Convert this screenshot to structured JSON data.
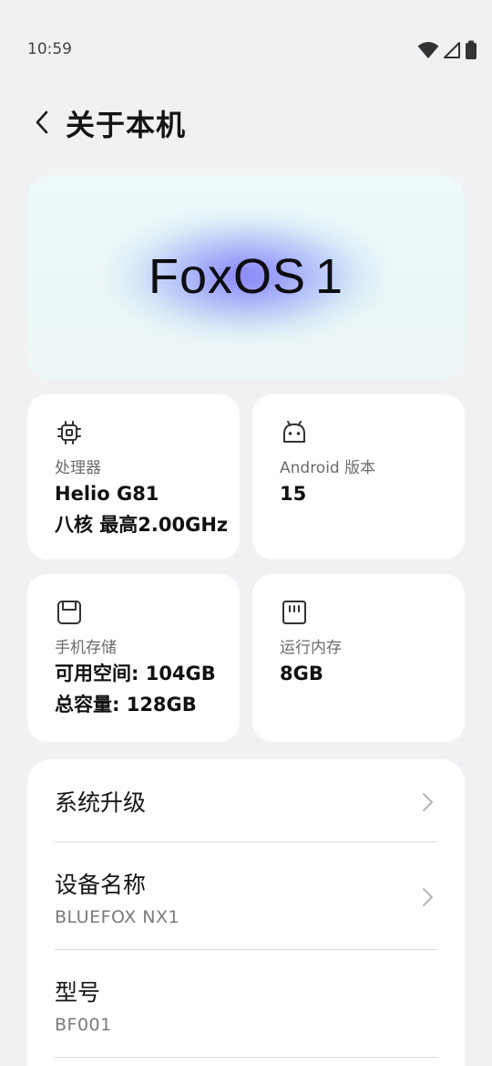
{
  "status_bar": {
    "time": "10:59",
    "icons": [
      "wifi-icon",
      "signal-icon",
      "battery-icon"
    ]
  },
  "header": {
    "back_icon": "back-arrow-icon",
    "title": "关于本机"
  },
  "banner": {
    "logo_text": "FoxOS",
    "logo_version": "1"
  },
  "cards": {
    "processor": {
      "icon": "chip-icon",
      "label": "处理器",
      "line1": "Helio G81",
      "line2": "八核 最高2.00GHz"
    },
    "android": {
      "icon": "android-icon",
      "label": "Android 版本",
      "line1": "15"
    },
    "storage": {
      "icon": "storage-icon",
      "label": "手机存储",
      "line1": "可用空间: 104GB",
      "line2": "总容量: 128GB"
    },
    "ram": {
      "icon": "memory-card-icon",
      "label": "运行内存",
      "line1": "8GB"
    }
  },
  "list": {
    "items": [
      {
        "title": "系统升级",
        "chevron": true
      },
      {
        "title": "设备名称",
        "value": "BLUEFOX NX1",
        "chevron": true
      },
      {
        "title": "型号",
        "value": "BF001"
      }
    ]
  },
  "colors": {
    "background": "#f0f1f3",
    "card": "#ffffff",
    "glow": "#736ef5"
  }
}
